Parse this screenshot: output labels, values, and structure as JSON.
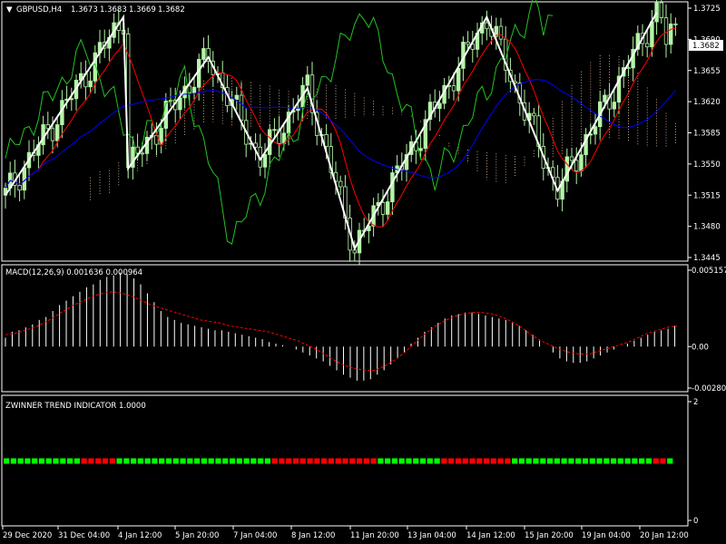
{
  "chart_data": [
    {
      "type": "candlestick",
      "title": "GBPUSD,H4",
      "ohlc_header": [
        "1.3673",
        "1.3683",
        "1.3669",
        "1.3682"
      ],
      "current_price": "1.3682",
      "y_ticks": [
        "1.3725",
        "1.3690",
        "1.3655",
        "1.3620",
        "1.3585",
        "1.3550",
        "1.3515",
        "1.3480",
        "1.3445"
      ],
      "ylim": [
        1.3445,
        1.3725
      ],
      "x_labels": [
        "29 Dec 2020",
        "31 Dec 04:00",
        "4 Jan 12:00",
        "5 Jan 20:00",
        "7 Jan 04:00",
        "8 Jan 12:00",
        "11 Jan 20:00",
        "13 Jan 04:00",
        "14 Jan 12:00",
        "15 Jan 20:00",
        "19 Jan 04:00",
        "20 Jan 12:00"
      ],
      "zigzag": [
        [
          0,
          1.3515
        ],
        [
          25,
          1.3715
        ],
        [
          26,
          1.3545
        ],
        [
          43,
          1.367
        ],
        [
          54,
          1.3555
        ],
        [
          64,
          1.3635
        ],
        [
          74,
          1.3455
        ],
        [
          102,
          1.3715
        ],
        [
          117,
          1.352
        ],
        [
          138,
          1.372
        ]
      ],
      "colors": {
        "candle": "#b3f5a6",
        "zigzag": "#ffffff",
        "red_line": "#ff0000",
        "blue_line": "#0000ff",
        "green_line": "#22c322",
        "cloud": "#f5c8a8"
      }
    },
    {
      "type": "macd",
      "title": "MACD(12,26,9) 0.001636 0.000964",
      "y_ticks": [
        "0.005157",
        "0.00",
        "-0.00280"
      ],
      "ylim": [
        -0.0028,
        0.005157
      ],
      "histogram": [
        0.0006,
        0.001,
        0.0011,
        0.0013,
        0.0015,
        0.0018,
        0.002,
        0.0024,
        0.0028,
        0.0031,
        0.0034,
        0.0037,
        0.004,
        0.0042,
        0.0045,
        0.0047,
        0.0048,
        0.005,
        0.0049,
        0.0046,
        0.0042,
        0.0036,
        0.003,
        0.0024,
        0.002,
        0.0018,
        0.0016,
        0.0015,
        0.0014,
        0.0013,
        0.0012,
        0.0011,
        0.0011,
        0.001,
        0.0009,
        0.0008,
        0.0007,
        0.0006,
        0.0005,
        0.0003,
        0.0002,
        0.0001,
        0.0,
        -0.0002,
        -0.0004,
        -0.0006,
        -0.0008,
        -0.001,
        -0.0013,
        -0.0016,
        -0.0019,
        -0.0021,
        -0.0023,
        -0.0023,
        -0.0022,
        -0.0019,
        -0.0016,
        -0.0012,
        -0.0008,
        -0.0004,
        0.0002,
        0.0006,
        0.001,
        0.0013,
        0.0016,
        0.0019,
        0.0021,
        0.0022,
        0.0023,
        0.0023,
        0.0022,
        0.0021,
        0.002,
        0.0019,
        0.0018,
        0.0016,
        0.0014,
        0.0011,
        0.0008,
        0.0004,
        0.0,
        -0.0004,
        -0.0008,
        -0.001,
        -0.0011,
        -0.0011,
        -0.001,
        -0.0008,
        -0.0006,
        -0.0004,
        -0.0002,
        0.0,
        0.0002,
        0.0004,
        0.0006,
        0.0008,
        0.001,
        0.0011,
        0.0012,
        0.0014
      ],
      "signal": [
        0.0008,
        0.0009,
        0.0011,
        0.0013,
        0.0016,
        0.002,
        0.0024,
        0.0028,
        0.0031,
        0.0034,
        0.0036,
        0.0037,
        0.0036,
        0.0034,
        0.0031,
        0.0028,
        0.0026,
        0.0024,
        0.0022,
        0.002,
        0.0018,
        0.0017,
        0.0016,
        0.0014,
        0.0013,
        0.0012,
        0.0011,
        0.001,
        0.0008,
        0.0006,
        0.0004,
        0.0001,
        -0.0002,
        -0.0006,
        -0.001,
        -0.0013,
        -0.0015,
        -0.0016,
        -0.0016,
        -0.0013,
        -0.0009,
        -0.0004,
        0.0002,
        0.0008,
        0.0013,
        0.0017,
        0.002,
        0.0022,
        0.0023,
        0.0023,
        0.0022,
        0.002,
        0.0017,
        0.0013,
        0.0008,
        0.0004,
        0.0001,
        -0.0002,
        -0.0004,
        -0.0005,
        -0.0005,
        -0.0003,
        -0.0001,
        0.0001,
        0.0003,
        0.0006,
        0.0009,
        0.0011,
        0.0013,
        0.0014
      ],
      "colors": {
        "histogram": "#ffffff",
        "signal": "#ff0000"
      }
    },
    {
      "type": "indicator",
      "title": "ZWINNER TREND INDICATOR 1.0000",
      "y_ticks": [
        "2",
        "0"
      ],
      "ylim": [
        0,
        2
      ],
      "level": 1,
      "states": "GGGGGGGGGGGRRRRRGGGGGGGGGGGGGGGGGGGGGGRRRRRRRRRRRRRRRGGGGGGGGGRRRRRRRRRRGGGGGGGGGGGGGGGGGGGGRRG",
      "colors": {
        "G": "#00ff00",
        "R": "#ff0000"
      }
    }
  ]
}
